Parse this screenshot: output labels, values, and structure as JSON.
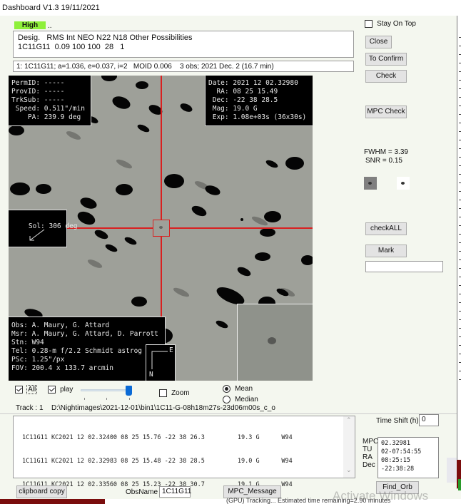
{
  "window": {
    "title": "Dashboard V1.3 19/11/2021"
  },
  "priority": {
    "label": "High",
    "dots": "..",
    "color": "#8ef03a"
  },
  "desig_box": {
    "header": "Desig.   RMS Int NEO N22 N18 Other Possibilities",
    "row": "1C11G11  0.09 100 100  28   1"
  },
  "orbit_summary": "1: 1C11G11; a=1.036, e=0.037, i=2   MOID 0.006    3 obs; 2021 Dec. 2 (16.7 min)",
  "image": {
    "top_left": "PermID: -----\nProvID: -----\nTrkSub: -----\n Speed: 0.511\"/min\n    PA: 239.9 deg",
    "top_right": "Date: 2021 12 02.32980\n  RA: 08 25 15.49\n Dec: -22 38 28.5\n Mag: 19.0 G\n Exp: 1.08e+03s (36x30s)",
    "sol": "Sol: 306 deg",
    "bottom_left": "Obs: A. Maury, G. Attard\nMsr: A. Maury, G. Attard, D. Parrott\nStn: W94\nTel: 0.28-m f/2.2 Schmidt astrog\nPSc: 1.25\"/px\nFOV: 200.4 x 133.7 arcmin",
    "compass_e": "E",
    "compass_n": "N"
  },
  "side": {
    "stay_on_top": "Stay On Top",
    "stay_on_top_checked": false,
    "close": "Close",
    "to_confirm": "To Confirm",
    "check": "Check",
    "mpc_check": "MPC Check",
    "fwhm": "FWHM = 3.39",
    "snr": "SNR  = 0.15",
    "check_all": "checkALL",
    "mark": "Mark",
    "mark_input": ""
  },
  "controls": {
    "all_label": "All",
    "all_checked": true,
    "play_label": "play",
    "play_checked": true,
    "slider_value_fraction": 1.0,
    "zoom_label": "Zoom",
    "zoom_checked": false,
    "mean_label": "Mean",
    "median_label": "Median",
    "selected_stat": "Mean",
    "track_label": "Track : 1",
    "file_path": "D:\\Nightimages\\2021-12-01\\bin1\\1C11-G-08h18m27s-23d06m00s_c_o"
  },
  "observations": [
    "1C11G11 KC2021 12 02.32400 08 25 15.76 -22 38 26.3         19.3 G      W94",
    "1C11G11 KC2021 12 02.32983 08 25 15.48 -22 38 28.5         19.0 G      W94",
    "1C11G11 KC2021 12 02.33560 08 25 15.23 -22 38 30.7         19.1 G      W94"
  ],
  "time_shift": {
    "label": "Time Shift (h)",
    "value": "0"
  },
  "mpc_panel": {
    "labels": [
      "MPC",
      "TU",
      "RA",
      "Dec"
    ],
    "values": "02.32981\n02-07:54:55\n08:25:15\n-22:38:28"
  },
  "bottom": {
    "clipboard_copy": "clipboard copy",
    "obsname_label": "ObsName",
    "obsname_value": "1C11G11",
    "mpc_message": "MPC_Message",
    "find_orb": "Find_Orb",
    "status_text": "(GPU) Tracking... Estimated time remaining=2.90 minutes",
    "watermark": "Activate Windows"
  }
}
